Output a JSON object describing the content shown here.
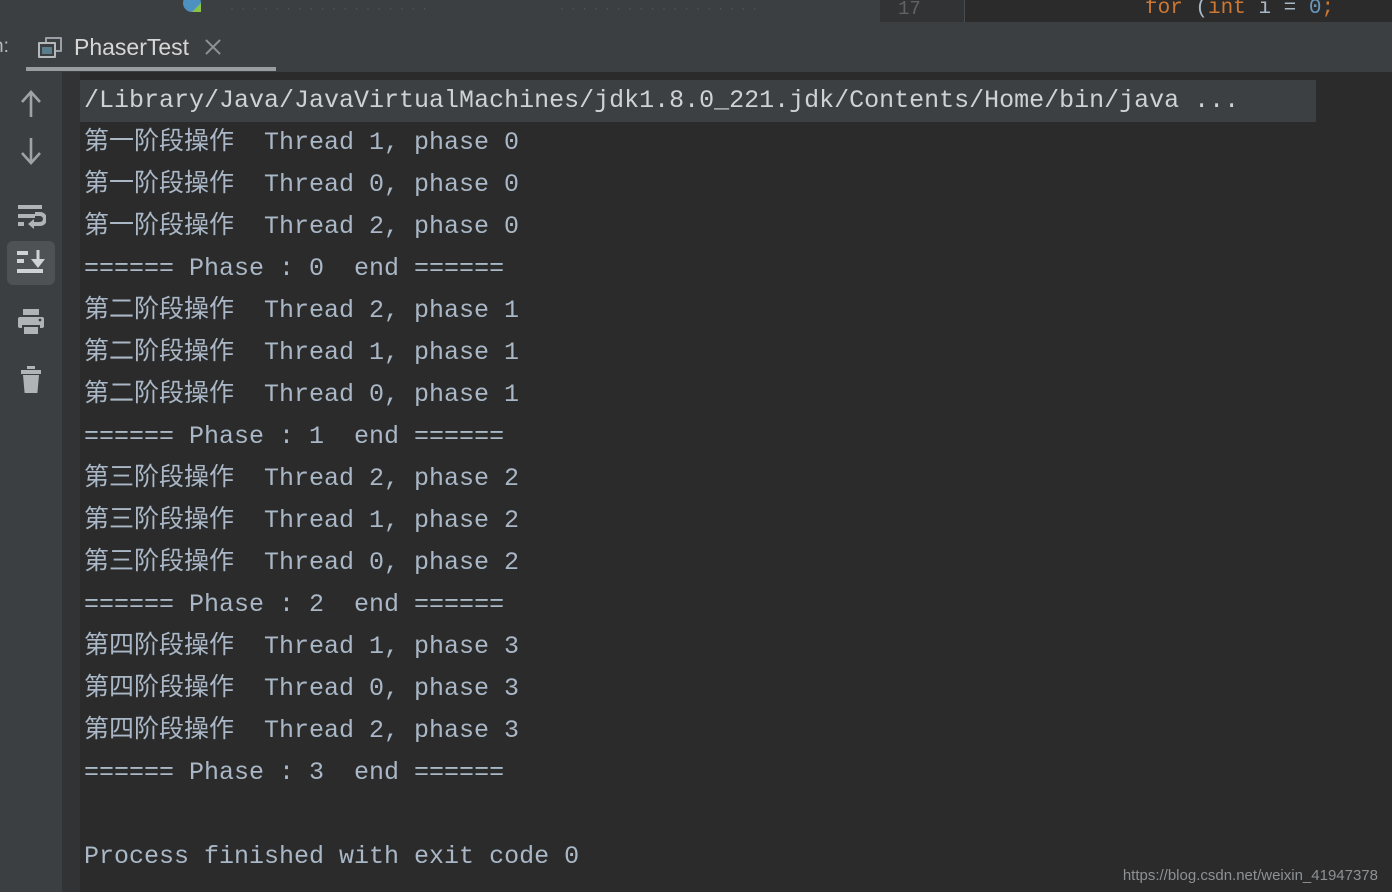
{
  "window": {
    "editor_sliver": {
      "line_number": "17",
      "code_fragment": "for (int i = 0;",
      "code_tokens": [
        {
          "text": "for ",
          "kind": "keyword"
        },
        {
          "text": "(",
          "kind": "punct"
        },
        {
          "text": "int",
          "kind": "keyword"
        },
        {
          "text": " i ",
          "kind": "punct"
        },
        {
          "text": "= ",
          "kind": "punct"
        },
        {
          "text": "0",
          "kind": "number"
        },
        {
          "text": ";",
          "kind": "punct"
        }
      ],
      "ghost_toolbar_text": "· ·  · ·  · ·   · ·  · ·  · ·    · ·  · ·   · ·"
    },
    "tool_window_label": "n:",
    "tool_window_label_full": "Run:"
  },
  "tab": {
    "icon": "run-configuration-icon",
    "title": "PhaserTest",
    "close_label": "close-tab"
  },
  "toolbar": {
    "items": [
      {
        "name": "up-arrow-icon",
        "label": "Up the Stack Trace",
        "active": false
      },
      {
        "name": "down-arrow-icon",
        "label": "Down the Stack Trace",
        "active": false
      },
      {
        "name": "soft-wrap-icon",
        "label": "Soft-Wrap",
        "active": false
      },
      {
        "name": "scroll-to-end-icon",
        "label": "Scroll to End",
        "active": true
      },
      {
        "name": "print-icon",
        "label": "Print",
        "active": false
      },
      {
        "name": "trash-icon",
        "label": "Clear All",
        "active": false
      }
    ]
  },
  "console": {
    "command_line": "/Library/Java/JavaVirtualMachines/jdk1.8.0_221.jdk/Contents/Home/bin/java ...",
    "lines": [
      "第一阶段操作  Thread 1, phase 0",
      "第一阶段操作  Thread 0, phase 0",
      "第一阶段操作  Thread 2, phase 0",
      "====== Phase : 0  end ======",
      "第二阶段操作  Thread 2, phase 1",
      "第二阶段操作  Thread 1, phase 1",
      "第二阶段操作  Thread 0, phase 1",
      "====== Phase : 1  end ======",
      "第三阶段操作  Thread 2, phase 2",
      "第三阶段操作  Thread 1, phase 2",
      "第三阶段操作  Thread 0, phase 2",
      "====== Phase : 2  end ======",
      "第四阶段操作  Thread 1, phase 3",
      "第四阶段操作  Thread 0, phase 3",
      "第四阶段操作  Thread 2, phase 3",
      "====== Phase : 3  end ======",
      "",
      "Process finished with exit code 0"
    ],
    "exit_line": "Process finished with exit code 0"
  },
  "watermark": "https://blog.csdn.net/weixin_41947378",
  "colors": {
    "console_bg": "#2b2b2b",
    "chrome_bg": "#3c3f41",
    "gutter_bg": "#313335",
    "text": "#a9b7c6",
    "command_bg": "#3c4043",
    "keyword": "#cc7832",
    "number": "#6897bb",
    "active_tool_bg": "#4e5254"
  }
}
